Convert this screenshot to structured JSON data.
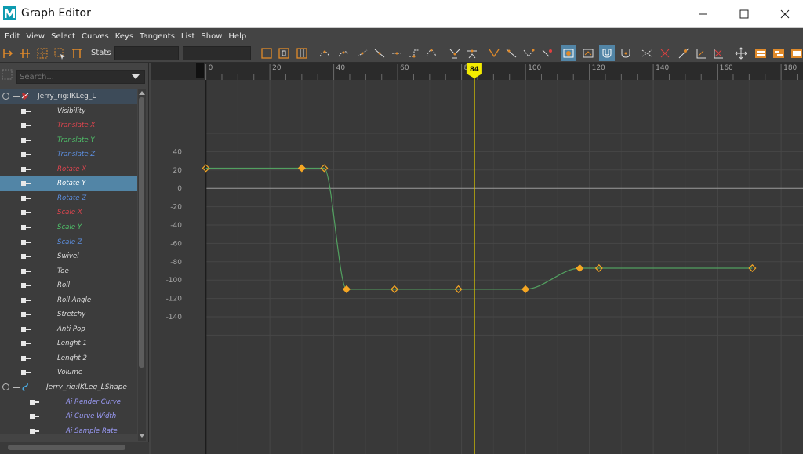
{
  "window": {
    "title": "Graph Editor",
    "controls": [
      "minimize",
      "maximize",
      "close"
    ]
  },
  "menu": [
    "Edit",
    "View",
    "Select",
    "Curves",
    "Keys",
    "Tangents",
    "List",
    "Show",
    "Help"
  ],
  "toolbar": {
    "stats_label": "Stats",
    "stats_value_1": "",
    "stats_value_2": ""
  },
  "search": {
    "placeholder": "Search..."
  },
  "outliner": {
    "nodes": [
      {
        "name": "Jerry_rig:IKLeg_L",
        "attributes": [
          {
            "label": "Visibility",
            "color": "#dcdcdc"
          },
          {
            "label": "Translate X",
            "color": "#e0454f"
          },
          {
            "label": "Translate Y",
            "color": "#4fc26a"
          },
          {
            "label": "Translate Z",
            "color": "#5d8fe0"
          },
          {
            "label": "Rotate X",
            "color": "#e0454f"
          },
          {
            "label": "Rotate Y",
            "color": "#ffffff",
            "selected": true
          },
          {
            "label": "Rotate Z",
            "color": "#5d8fe0"
          },
          {
            "label": "Scale X",
            "color": "#e0454f"
          },
          {
            "label": "Scale Y",
            "color": "#4fc26a"
          },
          {
            "label": "Scale Z",
            "color": "#5d8fe0"
          },
          {
            "label": "Swivel",
            "color": "#dcdcdc"
          },
          {
            "label": "Toe",
            "color": "#dcdcdc"
          },
          {
            "label": "Roll",
            "color": "#dcdcdc"
          },
          {
            "label": "Roll Angle",
            "color": "#dcdcdc"
          },
          {
            "label": "Stretchy",
            "color": "#dcdcdc"
          },
          {
            "label": "Anti Pop",
            "color": "#dcdcdc"
          },
          {
            "label": "Lenght 1",
            "color": "#dcdcdc"
          },
          {
            "label": "Lenght 2",
            "color": "#dcdcdc"
          },
          {
            "label": "Volume",
            "color": "#dcdcdc"
          }
        ]
      },
      {
        "name": "Jerry_rig:IKLeg_LShape",
        "attributes": [
          {
            "label": "Ai Render Curve",
            "color": "#9a9af5"
          },
          {
            "label": "Ai Curve Width",
            "color": "#9a9af5"
          },
          {
            "label": "Ai Sample Rate",
            "color": "#9a9af5"
          }
        ]
      }
    ]
  },
  "graph": {
    "current_frame": "84",
    "current_frame_value": 84,
    "x_ticks": [
      "0",
      "20",
      "40",
      "60",
      "80",
      "100",
      "120",
      "140",
      "160",
      "180"
    ],
    "y_ticks": [
      "40",
      "20",
      "0",
      "-20",
      "-40",
      "-60",
      "-80",
      "-100",
      "-120",
      "-140"
    ],
    "x_range": [
      0,
      180
    ],
    "y_range": [
      -140,
      40
    ],
    "curve_color": "#52a060",
    "key_color": "#f5a623",
    "keys": [
      {
        "frame": 0,
        "value": 22
      },
      {
        "frame": 30,
        "value": 22
      },
      {
        "frame": 37,
        "value": 22
      },
      {
        "frame": 44,
        "value": -110
      },
      {
        "frame": 59,
        "value": -110
      },
      {
        "frame": 79,
        "value": -110
      },
      {
        "frame": 100,
        "value": -110
      },
      {
        "frame": 117,
        "value": -87
      },
      {
        "frame": 123,
        "value": -87
      },
      {
        "frame": 171,
        "value": -87
      }
    ]
  }
}
